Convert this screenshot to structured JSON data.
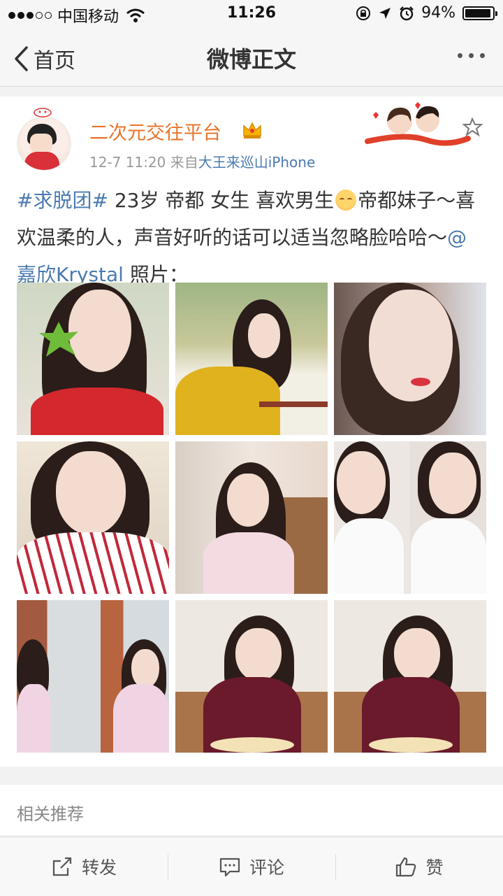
{
  "status_bar": {
    "carrier": "中国移动",
    "time": "11:26",
    "battery": "94%",
    "battery_level": 0.94
  },
  "nav": {
    "back_label": "首页",
    "title": "微博正文"
  },
  "post": {
    "user_name": "二次元交往平台",
    "time": "12-7 11:20",
    "source_prefix": "来自",
    "source_name": "大王来巡山iPhone",
    "hashtag": "#求脱团#",
    "text_1": " 23岁 帝都 女生 喜欢男生",
    "text_2": "帝都妹子～喜欢温柔的人，声音好听的话可以适当忽略脸哈哈～",
    "mention": "@嘉欣Krystal",
    "text_3": " 照片：",
    "photo_count": 9
  },
  "related": {
    "label": "相关推荐"
  },
  "toolbar": {
    "repost_label": "转发",
    "comment_label": "评论",
    "like_label": "赞"
  },
  "colors": {
    "username": "#e8732a",
    "link": "#4a7ab0"
  }
}
